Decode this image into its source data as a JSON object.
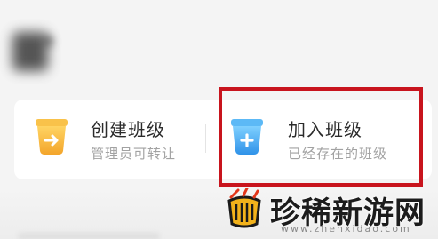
{
  "class_options": {
    "create": {
      "title": "创建班级",
      "subtitle": "管理员可转让",
      "icon": "orange-cup-arrow-icon",
      "color": "#f6b83a"
    },
    "join": {
      "title": "加入班级",
      "subtitle": "已经存在的班级",
      "icon": "blue-cup-plus-icon",
      "color": "#3aa3ef"
    }
  },
  "highlight_color": "#c8141d",
  "watermark": {
    "text": "珍稀新游网",
    "url": "www.zhenxidao.com",
    "logo": "grill-logo-icon"
  }
}
